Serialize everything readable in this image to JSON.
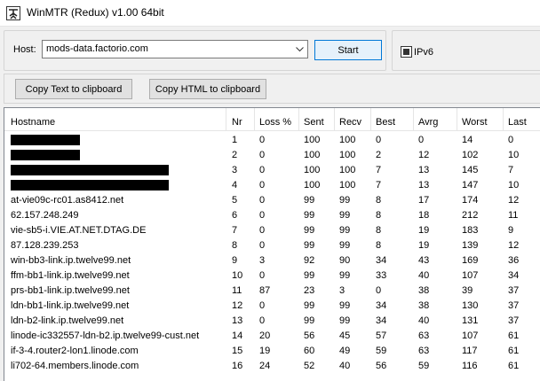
{
  "window": {
    "title": "WinMTR (Redux) v1.00 64bit"
  },
  "host": {
    "label": "Host:",
    "value": "mods-data.factorio.com",
    "start_label": "Start"
  },
  "ipv6": {
    "label": "IPv6",
    "checked": true
  },
  "buttons": {
    "copy_text": "Copy Text to clipboard",
    "copy_html": "Copy HTML to clipboard"
  },
  "table": {
    "columns": [
      "Hostname",
      "Nr",
      "Loss %",
      "Sent",
      "Recv",
      "Best",
      "Avrg",
      "Worst",
      "Last"
    ],
    "rows": [
      [
        "",
        "1",
        "0",
        "100",
        "100",
        "0",
        "0",
        "14",
        "0"
      ],
      [
        "",
        "2",
        "0",
        "100",
        "100",
        "2",
        "12",
        "102",
        "10"
      ],
      [
        "",
        "3",
        "0",
        "100",
        "100",
        "7",
        "13",
        "145",
        "7"
      ],
      [
        "",
        "4",
        "0",
        "100",
        "100",
        "7",
        "13",
        "147",
        "10"
      ],
      [
        "at-vie09c-rc01.as8412.net",
        "5",
        "0",
        "99",
        "99",
        "8",
        "17",
        "174",
        "12"
      ],
      [
        "62.157.248.249",
        "6",
        "0",
        "99",
        "99",
        "8",
        "18",
        "212",
        "11"
      ],
      [
        "vie-sb5-i.VIE.AT.NET.DTAG.DE",
        "7",
        "0",
        "99",
        "99",
        "8",
        "19",
        "183",
        "9"
      ],
      [
        "87.128.239.253",
        "8",
        "0",
        "99",
        "99",
        "8",
        "19",
        "139",
        "12"
      ],
      [
        "win-bb3-link.ip.twelve99.net",
        "9",
        "3",
        "92",
        "90",
        "34",
        "43",
        "169",
        "36"
      ],
      [
        "ffm-bb1-link.ip.twelve99.net",
        "10",
        "0",
        "99",
        "99",
        "33",
        "40",
        "107",
        "34"
      ],
      [
        "prs-bb1-link.ip.twelve99.net",
        "11",
        "87",
        "23",
        "3",
        "0",
        "38",
        "39",
        "37"
      ],
      [
        "ldn-bb1-link.ip.twelve99.net",
        "12",
        "0",
        "99",
        "99",
        "34",
        "38",
        "130",
        "37"
      ],
      [
        "ldn-b2-link.ip.twelve99.net",
        "13",
        "0",
        "99",
        "99",
        "34",
        "40",
        "131",
        "37"
      ],
      [
        "linode-ic332557-ldn-b2.ip.twelve99-cust.net",
        "14",
        "20",
        "56",
        "45",
        "57",
        "63",
        "107",
        "61"
      ],
      [
        "if-3-4.router2-lon1.linode.com",
        "15",
        "19",
        "60",
        "49",
        "59",
        "63",
        "117",
        "61"
      ],
      [
        "li702-64.members.linode.com",
        "16",
        "24",
        "52",
        "40",
        "56",
        "59",
        "116",
        "61"
      ]
    ],
    "redacted_rows": [
      0,
      1,
      2,
      3
    ]
  }
}
